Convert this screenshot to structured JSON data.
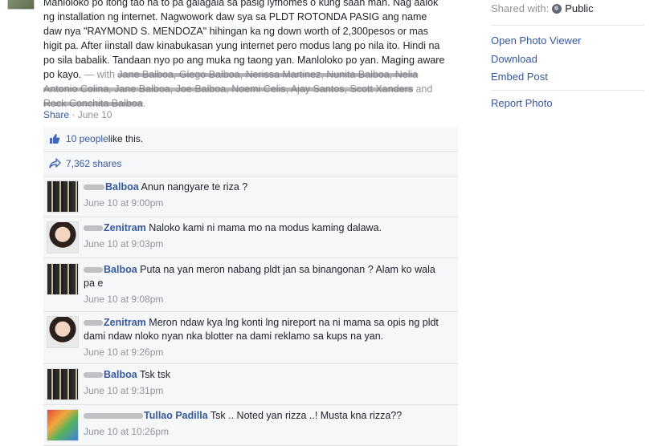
{
  "post": {
    "text_main": "Manloloko po itong tao na to pa galagala sa pasig lyfhomes o kung saan man. Nag aalok ng installation ng internet. Nagwowork daw sya sa PLDT ROTONDA PASIG ang name daw nya \"RAYMOND S. MENDOZA\" hihingan ka ng down worth of 2,300pesos or mas higit pa. After iinstall daw kinabukasan yung internet pero modus lang po nila ito. Hindi na po sila babalik. Tandaan nyo po ang muka ng taong yan. Manloloko po yan. Maging aware po kayo.",
    "with_label": " — with ",
    "tagged_names": "Jane Balboa, Glego Balboa, Nerissa Martinez, Nunita Balboa, Nelia Antonio Colina, Jane Balboa, Joe Balboa, Noemi Celis, Ajay Santos, Scott Xanders",
    "and_label": " and ",
    "tagged_last": "Rock Conchita Balboa",
    "period": ".",
    "share_label": "Share",
    "date_label": "June 10"
  },
  "likes": {
    "count_link": "10 people",
    "suffix": " like this."
  },
  "shares": {
    "text": "7,362 shares"
  },
  "comments": [
    {
      "author": "Balboa",
      "text": "Anun nangyare te riza ?",
      "time": "June 10 at 9:00pm"
    },
    {
      "author": "Zenitram",
      "text": "Naloko kami ni mama mo na modus kaming dalawa.",
      "time": "June 10 at 9:03pm"
    },
    {
      "author": "Balboa",
      "text": "Puta na yan meron nabang pldt jan sa binangonan ? Alam ko wala pa e",
      "time": "June 10 at 9:08pm"
    },
    {
      "author": "Zenitram",
      "text": "Meron ndaw kya lng konti lng nireport na ni mama sa opis ng pldt dami ndaw nloko nyan nka blotter na dami reklamo sa kups na yan.",
      "time": "June 10 at 9:26pm"
    },
    {
      "author": "Balboa",
      "text": "Tsk tsk",
      "time": "June 10 at 9:31pm"
    },
    {
      "author": "Tullao Padilla",
      "text": "Tsk .. Noted yan rizza ..! Musta kna rizza??",
      "time": "June 10 at 10:26pm"
    }
  ],
  "sidebar": {
    "shared_with_label": "Shared with:",
    "privacy": "Public",
    "links": [
      "Open Photo Viewer",
      "Download",
      "Embed Post",
      "Report Photo"
    ]
  }
}
